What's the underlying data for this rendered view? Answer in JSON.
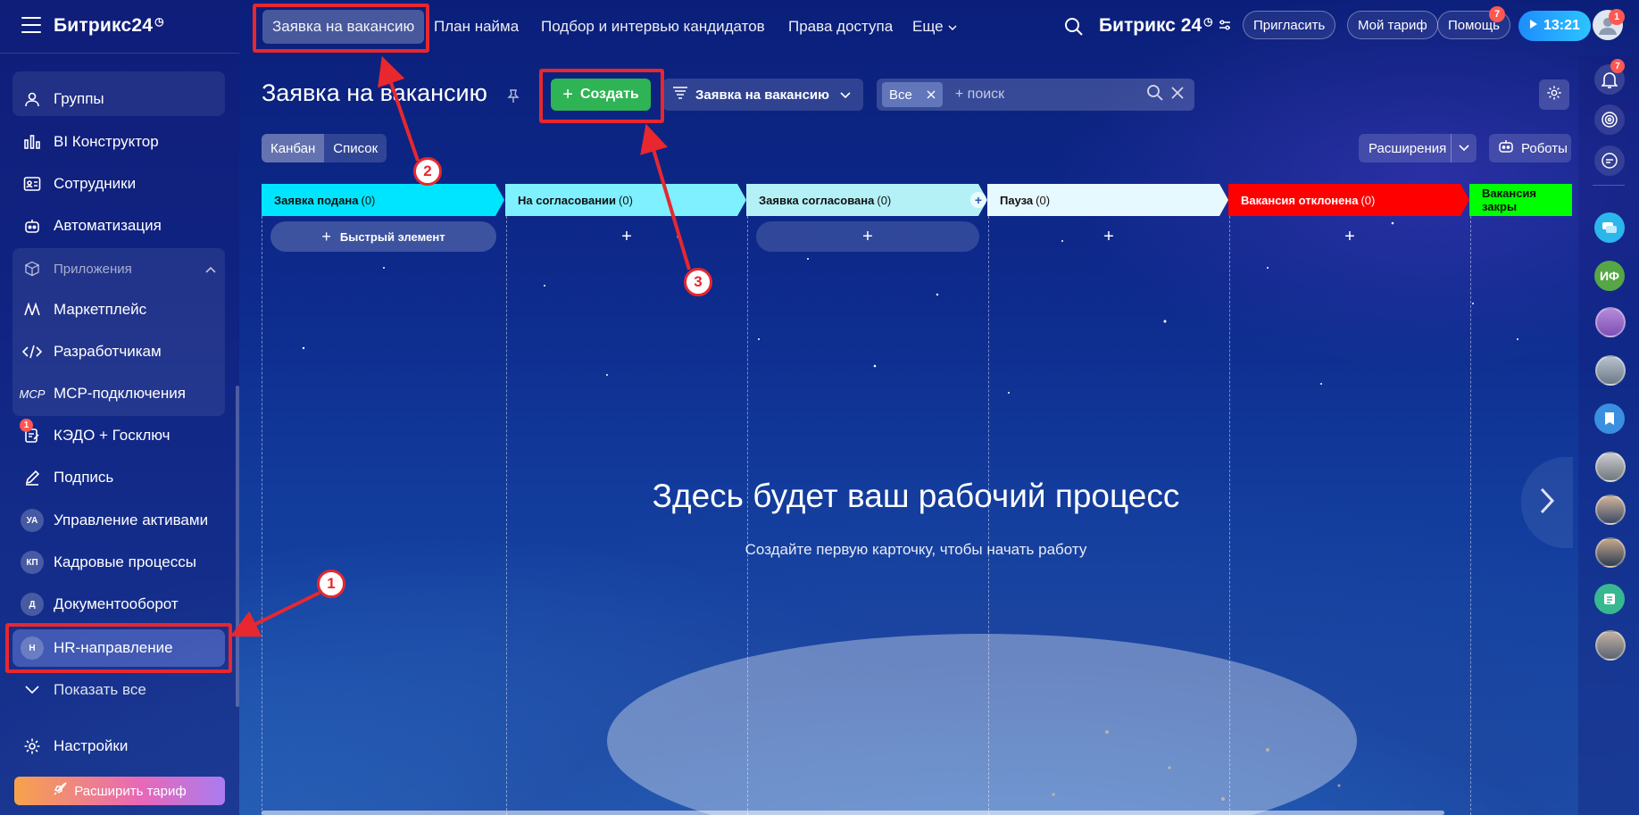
{
  "sidebar": {
    "logo": "Битрикс24",
    "items": [
      {
        "label": "Группы"
      },
      {
        "label": "BI Конструктор"
      },
      {
        "label": "Сотрудники"
      },
      {
        "label": "Автоматизация"
      }
    ],
    "apps_header": "Приложения",
    "apps": [
      {
        "label": "Маркетплейс"
      },
      {
        "label": "Разработчикам"
      },
      {
        "label": "MCP-подключения",
        "icon_text": "MCP"
      }
    ],
    "more_items": [
      {
        "label": "КЭДО + Госключ",
        "badge": "1"
      },
      {
        "label": "Подпись"
      },
      {
        "label": "Управление активами",
        "abbr": "УА"
      },
      {
        "label": "Кадровые процессы",
        "abbr": "КП"
      },
      {
        "label": "Документооборот",
        "abbr": "Д"
      },
      {
        "label": "HR-направление",
        "abbr": "H"
      }
    ],
    "show_all": "Показать все",
    "settings": "Настройки",
    "upgrade": "Расширить тариф"
  },
  "topbar": {
    "tabs": [
      "Заявка на вакансию",
      "План найма",
      "Подбор и интервью кандидатов",
      "Права доступа",
      "Еще"
    ],
    "brand": "Битрикс 24",
    "invite": "Пригласить",
    "tariff": "Мой тариф",
    "help": "Помощь",
    "help_badge": "7",
    "time": "13:21",
    "avatar_badge": "1"
  },
  "main": {
    "title": "Заявка на вакансию",
    "create": "Создать",
    "category": "Заявка на вакансию",
    "filter_chip": "Все",
    "search_placeholder": "+ поиск",
    "view_kanban": "Канбан",
    "view_list": "Список",
    "extensions": "Расширения",
    "robots": "Роботы",
    "empty_title": "Здесь будет ваш рабочий процесс",
    "empty_sub": "Создайте первую карточку, чтобы начать работу",
    "quick_item": "Быстрый элемент"
  },
  "columns": [
    {
      "name": "Заявка подана",
      "count": "(0)",
      "color": "#00e5ff"
    },
    {
      "name": "На согласовании",
      "count": "(0)",
      "color": "#7ef0ff"
    },
    {
      "name": "Заявка согласована",
      "count": "(0)",
      "color": "#b4f1f7"
    },
    {
      "name": "Пауза",
      "count": "(0)",
      "color": "#e6f9ff"
    },
    {
      "name": "Вакансия отклонена",
      "count": "(0)",
      "color": "#ff0000"
    },
    {
      "name": "Вакансия закры",
      "count": "",
      "color": "#00ff00"
    }
  ],
  "rightbar": {
    "notif_badge": "7",
    "avatar_abbr": "ИФ"
  },
  "annotations": {
    "n1": "1",
    "n2": "2",
    "n3": "3",
    "color": "#e8272f"
  }
}
